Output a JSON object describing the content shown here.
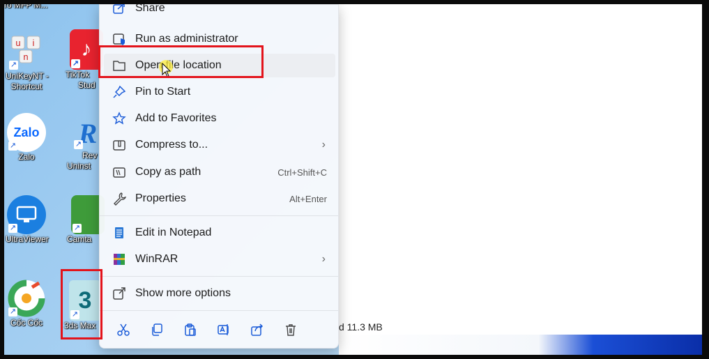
{
  "desktop_icons": [
    {
      "label": "ro MFP M...",
      "icon": "printer-icon"
    },
    {
      "label_line1": "UniKeyNT -",
      "label_line2": "Shortcut",
      "icon": "unikey-icon"
    },
    {
      "label_line1": "TikTok",
      "label_line2": "Stud",
      "icon": "tiktok-icon"
    },
    {
      "label": "Zalo",
      "icon_text": "Zalo",
      "icon": "zalo-icon"
    },
    {
      "label_line1": "Rev",
      "label_line2": "Uninst",
      "icon_text": "R",
      "icon": "revo-uninstaller-icon"
    },
    {
      "label": "UltraViewer",
      "icon": "ultraviewer-icon"
    },
    {
      "label": "Camta",
      "icon": "camtasia-icon"
    },
    {
      "label": "Cốc Cốc",
      "icon": "coccoc-icon"
    },
    {
      "label": "3ds Max",
      "icon_text": "3",
      "icon": "3dsmax-icon"
    }
  ],
  "context_menu": {
    "items": [
      {
        "label": "Share",
        "icon": "share-icon"
      },
      {
        "label": "Run as administrator",
        "icon": "shield-icon"
      },
      {
        "label": "Open file location",
        "icon": "folder-icon"
      },
      {
        "label": "Pin to Start",
        "icon": "pin-icon"
      },
      {
        "label": "Add to Favorites",
        "icon": "star-icon"
      },
      {
        "label": "Compress to...",
        "icon": "zip-icon",
        "chevron": "›"
      },
      {
        "label": "Copy as path",
        "icon": "path-icon",
        "shortcut": "Ctrl+Shift+C"
      },
      {
        "label": "Properties",
        "icon": "wrench-icon",
        "shortcut": "Alt+Enter"
      },
      {
        "label": "Edit in Notepad",
        "icon": "notepad-icon"
      },
      {
        "label": "WinRAR",
        "icon": "winrar-icon",
        "chevron": "›"
      },
      {
        "label": "Show more options",
        "icon": "more-options-icon"
      }
    ],
    "bottom_actions": [
      "cut-icon",
      "copy-icon",
      "paste-icon",
      "rename-icon",
      "share-icon",
      "delete-icon"
    ]
  },
  "status_bar": {
    "text": "d 11.3 MB"
  },
  "colors": {
    "highlight": "#e3131b",
    "menu_bg": "#f7f9fc",
    "accent": "#1a5bd8"
  }
}
